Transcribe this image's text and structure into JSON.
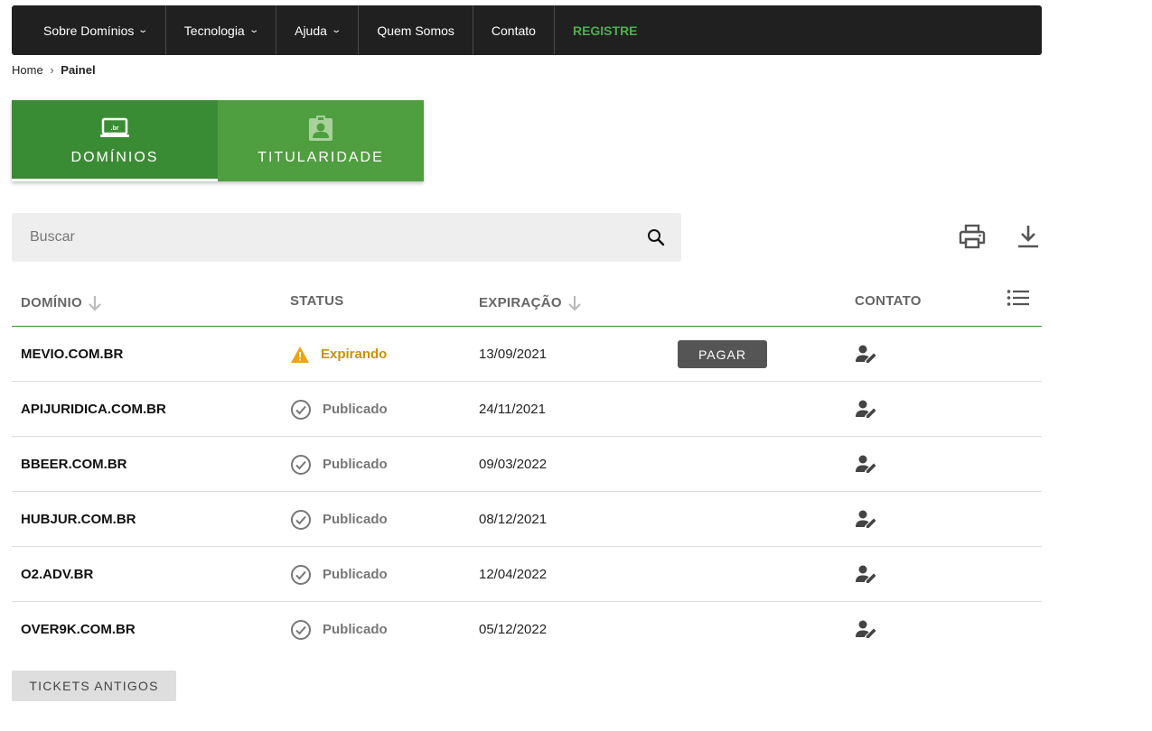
{
  "nav": {
    "items": [
      {
        "label": "Sobre Domínios",
        "dropdown": true
      },
      {
        "label": "Tecnologia",
        "dropdown": true
      },
      {
        "label": "Ajuda",
        "dropdown": true
      },
      {
        "label": "Quem Somos",
        "dropdown": false
      },
      {
        "label": "Contato",
        "dropdown": false
      }
    ],
    "register_label": "REGISTRE"
  },
  "breadcrumb": {
    "home": "Home",
    "separator": "›",
    "current": "Painel"
  },
  "tabs": [
    {
      "label": "DOMÍNIOS",
      "icon": "laptop-br-icon",
      "active": true
    },
    {
      "label": "TITULARIDADE",
      "icon": "contact-badge-icon",
      "active": false
    }
  ],
  "search": {
    "placeholder": "Buscar",
    "value": ""
  },
  "table": {
    "headers": {
      "domain": "DOMÍNIO",
      "status": "STATUS",
      "expiration": "EXPIRAÇÃO",
      "contact": "CONTATO"
    },
    "rows": [
      {
        "domain": "MEVIO.COM.BR",
        "status": "Expirando",
        "status_kind": "warning",
        "expiration": "13/09/2021",
        "action": "PAGAR"
      },
      {
        "domain": "APIJURIDICA.COM.BR",
        "status": "Publicado",
        "status_kind": "ok",
        "expiration": "24/11/2021",
        "action": ""
      },
      {
        "domain": "BBEER.COM.BR",
        "status": "Publicado",
        "status_kind": "ok",
        "expiration": "09/03/2022",
        "action": ""
      },
      {
        "domain": "HUBJUR.COM.BR",
        "status": "Publicado",
        "status_kind": "ok",
        "expiration": "08/12/2021",
        "action": ""
      },
      {
        "domain": "O2.ADV.BR",
        "status": "Publicado",
        "status_kind": "ok",
        "expiration": "12/04/2022",
        "action": ""
      },
      {
        "domain": "OVER9K.COM.BR",
        "status": "Publicado",
        "status_kind": "ok",
        "expiration": "05/12/2022",
        "action": ""
      }
    ]
  },
  "tickets_button": "TICKETS ANTIGOS",
  "colors": {
    "nav_bg": "#202020",
    "brand_green": "#3a8c34",
    "brand_green_light": "#4f9e3f",
    "register_green": "#4caf50",
    "warning": "#c8920e",
    "muted": "#777777",
    "pay_button": "#555555"
  }
}
